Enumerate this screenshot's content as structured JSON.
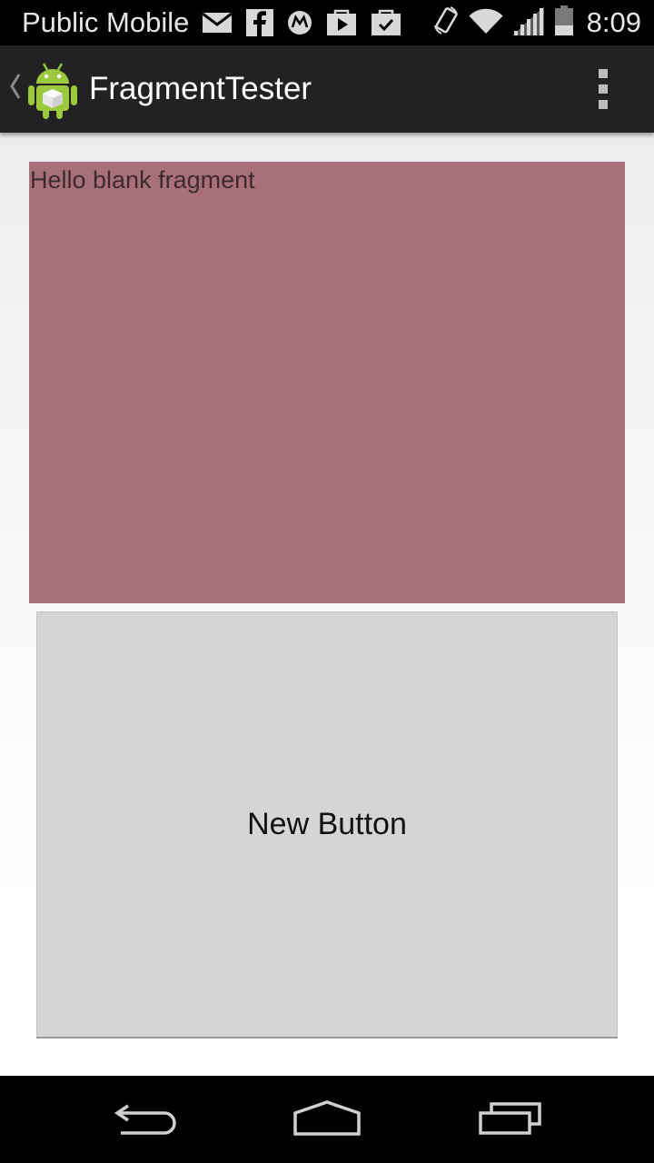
{
  "status_bar": {
    "carrier": "Public Mobile",
    "time": "8:09",
    "notification_icons": [
      "gmail-icon",
      "facebook-icon",
      "motorola-icon",
      "play-store-icon",
      "play-store-update-icon"
    ],
    "system_icons": [
      "screen-rotation-icon",
      "wifi-icon",
      "signal-icon",
      "battery-icon"
    ]
  },
  "action_bar": {
    "title": "FragmentTester",
    "up_icon": "chevron-left-icon",
    "app_icon": "android-robot-icon",
    "overflow_icon": "overflow-menu-icon"
  },
  "content": {
    "fragment_text": "Hello blank fragment",
    "fragment_color": "#a8717a",
    "button_label": "New Button"
  },
  "nav_bar": {
    "buttons": [
      "back-icon",
      "home-icon",
      "recents-icon"
    ]
  }
}
